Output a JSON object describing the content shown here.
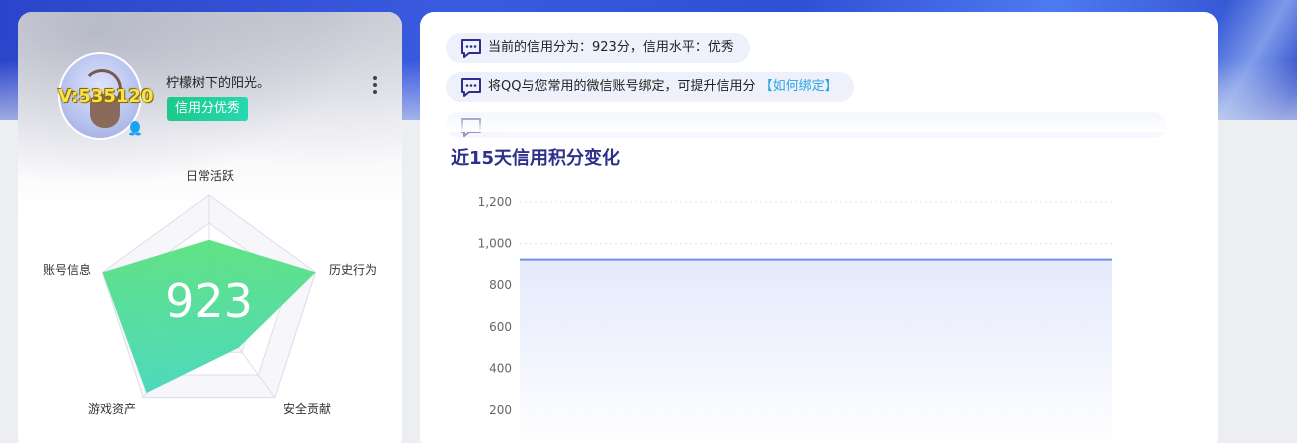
{
  "profile": {
    "vip_text": "V:535120",
    "username": "柠檬树下的阳光。",
    "badge": "信用分优秀"
  },
  "radar": {
    "score": "923",
    "labels": [
      "日常活跃",
      "历史行为",
      "安全贡献",
      "游戏资产",
      "账号信息"
    ],
    "values": [
      0.6,
      1.0,
      0.45,
      0.95,
      1.0
    ],
    "fill_top": "#55e07a",
    "fill_bottom": "#3fd6b8"
  },
  "notices": [
    {
      "text": "当前的信用分为：923分，信用水平：优秀",
      "link": ""
    },
    {
      "text": "将QQ与您常用的微信账号绑定，可提升信用分 ",
      "link": "【如何绑定】"
    }
  ],
  "chart_title": "近15天信用积分变化",
  "chart_data": {
    "type": "area",
    "title": "近15天信用积分变化",
    "xlabel": "",
    "ylabel": "",
    "yticks": [
      "1,200",
      "1,000",
      "800",
      "600",
      "400",
      "200"
    ],
    "ylim": [
      200,
      1200
    ],
    "series": [
      {
        "values": [
          923,
          923,
          923,
          923,
          923,
          923,
          923,
          923,
          923,
          923,
          923,
          923,
          923,
          923,
          923
        ]
      }
    ],
    "grid": true,
    "line_color": "#6f93e8",
    "area_color": "#e4e9fc"
  }
}
